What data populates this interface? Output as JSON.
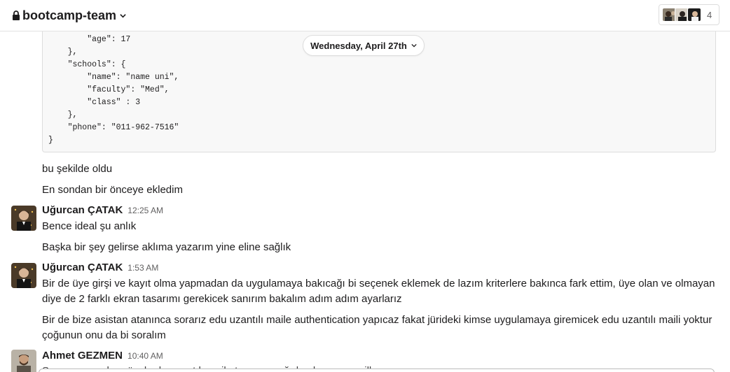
{
  "header": {
    "channel": "bootcamp-team",
    "member_count": "4"
  },
  "code": {
    "lines": [
      "        \"age\": 17",
      "    },",
      "    \"schools\": {",
      "        \"name\": \"name uni\",",
      "        \"faculty\": \"Med\",",
      "        \"class\" : 3",
      "    },",
      "    \"phone\": \"011-962-7516\"",
      "}"
    ]
  },
  "date_divider": "Wednesday, April 27th",
  "messages": [
    {
      "text": "bu şekilde oldu"
    },
    {
      "text": "En sondan bir önceye ekledim"
    },
    {
      "author": "Uğurcan ÇATAK",
      "time": "12:25 AM",
      "lines": [
        "Bence ideal şu anlık"
      ]
    },
    {
      "text": "Başka bir şey gelirse aklıma yazarım yine eline sağlık"
    },
    {
      "author": "Uğurcan ÇATAK",
      "time": "1:53 AM",
      "lines": [
        "Bir de üye girşi ve kayıt olma yapmadan da uygulamaya bakıcağı bi seçenek eklemek de lazım kriterlere bakınca fark ettim, üye olan ve olmayan",
        "diye de 2 farklı ekran tasarımı gerekicek sanırım bakalım adım adım ayarlarız"
      ]
    },
    {
      "lines": [
        "Bir de bize asistan atanınca sorarız edu uzantılı maile authentication yapıcaz fakat jürideki kimse uygulamaya giremicek edu uzantılı maili yoktur",
        "çoğunun onu da bi soralım"
      ]
    },
    {
      "author": "Ahmet GEZMEN",
      "time": "10:40 AM",
      "partial": "Şu yaparız onlara özel edu uzantılı mail oturuşu aşağıda olmayan mailler"
    }
  ],
  "colors": {
    "text": "#1d1c1d",
    "muted": "#616061",
    "code_bg": "#f8f8f8",
    "border": "#dddddd"
  }
}
